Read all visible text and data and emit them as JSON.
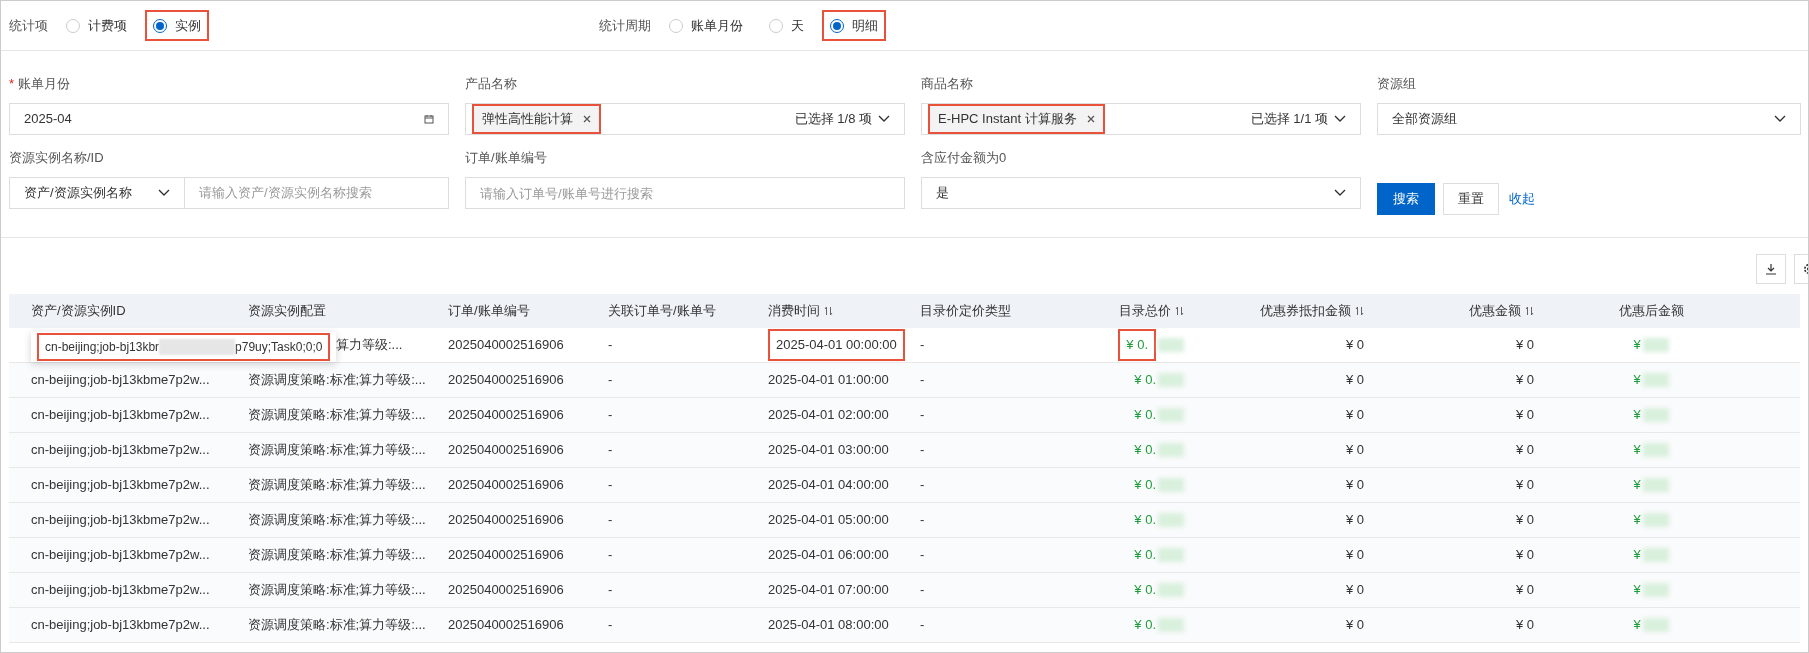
{
  "stat_item": {
    "label": "统计项",
    "options": [
      {
        "label": "计费项",
        "selected": false,
        "highlighted": false
      },
      {
        "label": "实例",
        "selected": true,
        "highlighted": true
      }
    ]
  },
  "stat_period": {
    "label": "统计周期",
    "options": [
      {
        "label": "账单月份",
        "selected": false,
        "highlighted": false
      },
      {
        "label": "天",
        "selected": false,
        "highlighted": false
      },
      {
        "label": "明细",
        "selected": true,
        "highlighted": true
      }
    ]
  },
  "filters": {
    "bill_month": {
      "label": "账单月份",
      "required_mark": "*",
      "value": "2025-04"
    },
    "product": {
      "label": "产品名称",
      "tag": "弹性高性能计算",
      "summary": "已选择 1/8 项",
      "highlighted": true
    },
    "commodity": {
      "label": "商品名称",
      "tag": "E-HPC Instant 计算服务",
      "summary": "已选择 1/1 项",
      "highlighted": true
    },
    "resource_group": {
      "label": "资源组",
      "value": "全部资源组"
    },
    "instance": {
      "label": "资源实例名称/ID",
      "type": "资产/资源实例名称",
      "placeholder": "请输入资产/资源实例名称搜索"
    },
    "order": {
      "label": "订单/账单编号",
      "placeholder": "请输入订单号/账单号进行搜索"
    },
    "zero_amount": {
      "label": "含应付金额为0",
      "value": "是"
    },
    "buttons": {
      "search": "搜索",
      "reset": "重置",
      "collapse": "收起"
    }
  },
  "table": {
    "columns": [
      {
        "label": "资产/资源实例ID",
        "sortable": false
      },
      {
        "label": "资源实例配置",
        "sortable": false
      },
      {
        "label": "订单/账单编号",
        "sortable": false
      },
      {
        "label": "关联订单号/账单号",
        "sortable": false
      },
      {
        "label": "消费时间",
        "sortable": true
      },
      {
        "label": "目录价定价类型",
        "sortable": false
      },
      {
        "label": "目录总价",
        "sortable": true
      },
      {
        "label": "优惠券抵扣金额",
        "sortable": true
      },
      {
        "label": "优惠金额",
        "sortable": true
      },
      {
        "label": "优惠后金额",
        "sortable": false
      }
    ],
    "rows": [
      {
        "cells": [
          "",
          "算力等级:...",
          "2025040002516906",
          "-",
          "2025-04-01 00:00:00",
          "-",
          "¥ 0.",
          "¥ 0",
          "¥ 0",
          "¥"
        ],
        "time_highlighted": true,
        "price_highlighted": true
      },
      {
        "cells": [
          "cn-beijing;job-bj13kbme7p2w...",
          "资源调度策略:标准;算力等级:...",
          "2025040002516906",
          "-",
          "2025-04-01 01:00:00",
          "-",
          "¥ 0.",
          "¥ 0",
          "¥ 0",
          "¥"
        ],
        "time_highlighted": false,
        "price_highlighted": false
      },
      {
        "cells": [
          "cn-beijing;job-bj13kbme7p2w...",
          "资源调度策略:标准;算力等级:...",
          "2025040002516906",
          "-",
          "2025-04-01 02:00:00",
          "-",
          "¥ 0.",
          "¥ 0",
          "¥ 0",
          "¥"
        ],
        "time_highlighted": false,
        "price_highlighted": false
      },
      {
        "cells": [
          "cn-beijing;job-bj13kbme7p2w...",
          "资源调度策略:标准;算力等级:...",
          "2025040002516906",
          "-",
          "2025-04-01 03:00:00",
          "-",
          "¥ 0.",
          "¥ 0",
          "¥ 0",
          "¥"
        ],
        "time_highlighted": false,
        "price_highlighted": false
      },
      {
        "cells": [
          "cn-beijing;job-bj13kbme7p2w...",
          "资源调度策略:标准;算力等级:...",
          "2025040002516906",
          "-",
          "2025-04-01 04:00:00",
          "-",
          "¥ 0.",
          "¥ 0",
          "¥ 0",
          "¥"
        ],
        "time_highlighted": false,
        "price_highlighted": false
      },
      {
        "cells": [
          "cn-beijing;job-bj13kbme7p2w...",
          "资源调度策略:标准;算力等级:...",
          "2025040002516906",
          "-",
          "2025-04-01 05:00:00",
          "-",
          "¥ 0.",
          "¥ 0",
          "¥ 0",
          "¥"
        ],
        "time_highlighted": false,
        "price_highlighted": false
      },
      {
        "cells": [
          "cn-beijing;job-bj13kbme7p2w...",
          "资源调度策略:标准;算力等级:...",
          "2025040002516906",
          "-",
          "2025-04-01 06:00:00",
          "-",
          "¥ 0.",
          "¥ 0",
          "¥ 0",
          "¥"
        ],
        "time_highlighted": false,
        "price_highlighted": false
      },
      {
        "cells": [
          "cn-beijing;job-bj13kbme7p2w...",
          "资源调度策略:标准;算力等级:...",
          "2025040002516906",
          "-",
          "2025-04-01 07:00:00",
          "-",
          "¥ 0.",
          "¥ 0",
          "¥ 0",
          "¥"
        ],
        "time_highlighted": false,
        "price_highlighted": false
      },
      {
        "cells": [
          "cn-beijing;job-bj13kbme7p2w...",
          "资源调度策略:标准;算力等级:...",
          "2025040002516906",
          "-",
          "2025-04-01 08:00:00",
          "-",
          "¥ 0.",
          "¥ 0",
          "¥ 0",
          "¥"
        ],
        "time_highlighted": false,
        "price_highlighted": false
      }
    ]
  },
  "tooltip": {
    "before": "cn-beijing;job-bj13kbr",
    "after": "p79uy;Task0;0;0",
    "highlighted": true
  }
}
